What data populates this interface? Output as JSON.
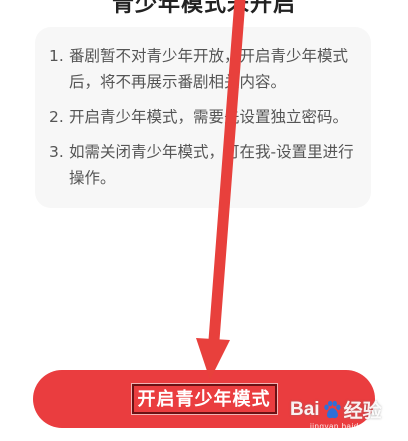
{
  "header": {
    "title": "青少年模式未开启"
  },
  "info_card": {
    "items": [
      {
        "num": "1.",
        "text": "番剧暂不对青少年开放，开启青少年模式后，将不再展示番剧相关内容。"
      },
      {
        "num": "2.",
        "text": "开启青少年模式，需要先设置独立密码。"
      },
      {
        "num": "3.",
        "text": "如需关闭青少年模式，可在我-设置里进行操作。"
      }
    ]
  },
  "primary_button": {
    "label": "开启青少年模式"
  },
  "annotation": {
    "arrow_color": "#e8403c",
    "highlight_color": "#6b1214"
  },
  "watermark": {
    "brand_left": "Bai",
    "brand_right": "经验",
    "url": "jingyan.baidu.com",
    "icon": "baidu-paw-icon"
  },
  "colors": {
    "accent": "#ea3d3f",
    "card_bg": "#f7f7f7",
    "text": "#555555",
    "title": "#222222"
  }
}
